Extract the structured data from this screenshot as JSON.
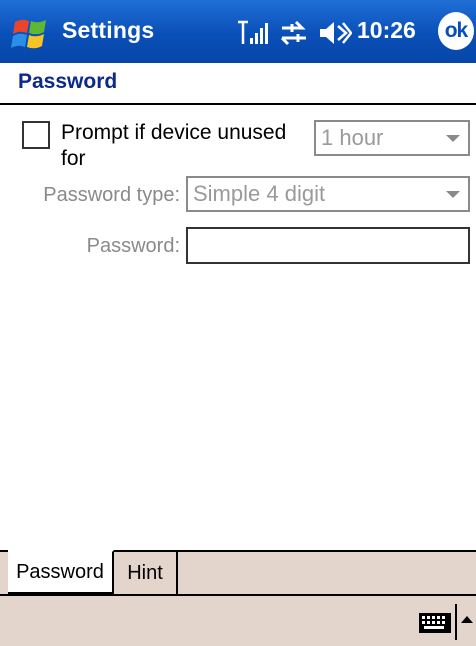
{
  "titlebar": {
    "title": "Settings",
    "time": "10:26",
    "ok_label": "ok",
    "icons": [
      "windows-start-icon",
      "signal-icon",
      "sync-icon",
      "volume-icon"
    ]
  },
  "header": {
    "title": "Password"
  },
  "form": {
    "prompt_label": "Prompt if device unused for",
    "prompt_checked": false,
    "timeout_value": "1 hour",
    "password_type_label": "Password type:",
    "password_type_value": "Simple 4 digit",
    "password_label": "Password:",
    "password_value": ""
  },
  "tabs": [
    {
      "label": "Password",
      "active": true
    },
    {
      "label": "Hint",
      "active": false
    }
  ],
  "colors": {
    "titlebar": "#0a4fb8",
    "header_text": "#0b2a8a",
    "bar_background": "#e3d4cc",
    "disabled_text": "#9a9a9a"
  }
}
